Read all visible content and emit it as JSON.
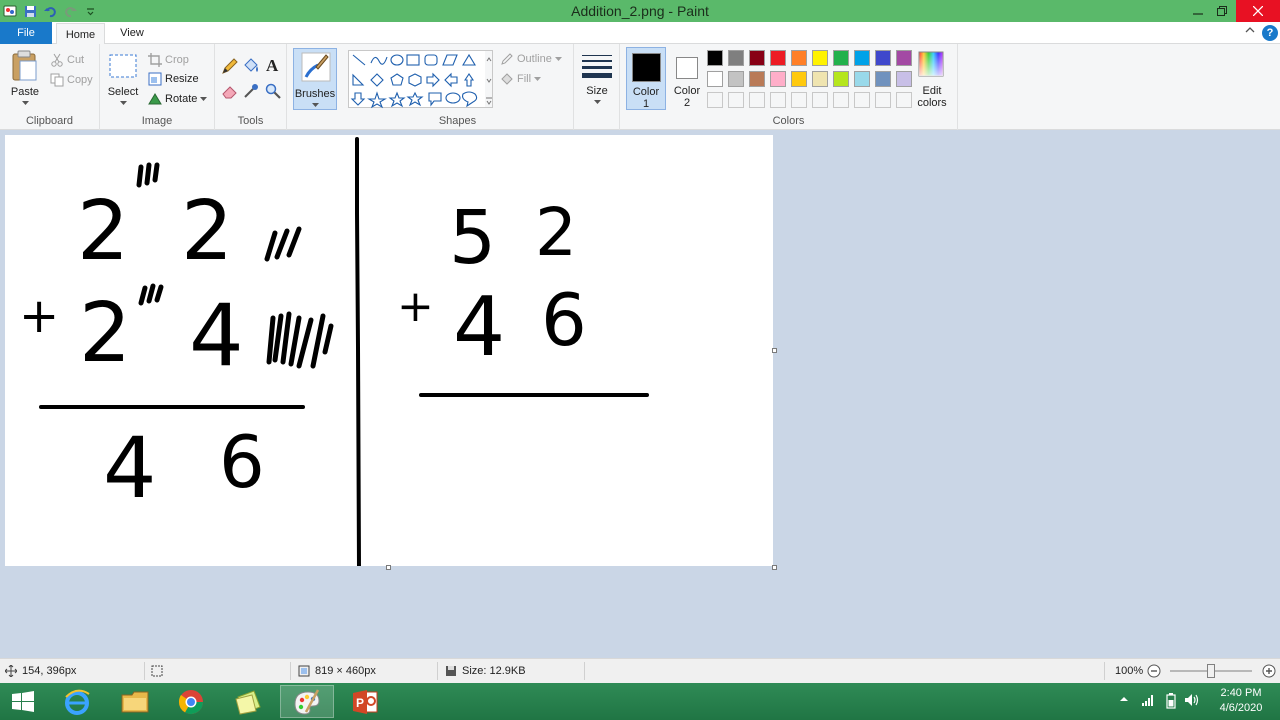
{
  "window": {
    "title": "Addition_2.png - Paint"
  },
  "tabs": {
    "file": "File",
    "home": "Home",
    "view": "View"
  },
  "ribbon": {
    "clipboard": {
      "group_label": "Clipboard",
      "paste": "Paste",
      "cut": "Cut",
      "copy": "Copy"
    },
    "image": {
      "group_label": "Image",
      "select": "Select",
      "crop": "Crop",
      "resize": "Resize",
      "rotate": "Rotate"
    },
    "tools": {
      "group_label": "Tools"
    },
    "brushes": {
      "label": "Brushes"
    },
    "shapes": {
      "group_label": "Shapes",
      "outline": "Outline",
      "fill": "Fill"
    },
    "size": {
      "label": "Size"
    },
    "colors": {
      "group_label": "Colors",
      "color1_line1": "Color",
      "color1_line2": "1",
      "color2_line1": "Color",
      "color2_line2": "2",
      "edit_line1": "Edit",
      "edit_line2": "colors",
      "color1": "#000000",
      "color2": "#ffffff",
      "palette_row1": [
        "#000000",
        "#7f7f7f",
        "#880015",
        "#ed1c24",
        "#ff7f27",
        "#fff200",
        "#22b14c",
        "#00a2e8",
        "#3f48cc",
        "#a349a4"
      ],
      "palette_row2": [
        "#ffffff",
        "#c3c3c3",
        "#b97a57",
        "#ffaec9",
        "#ffc90e",
        "#efe4b0",
        "#b5e61d",
        "#99d9ea",
        "#7092be",
        "#c8bfe7"
      ]
    }
  },
  "canvas": {
    "left_problem": {
      "row1": [
        "2",
        "2"
      ],
      "row2_operator": "+",
      "row2": [
        "2",
        "4"
      ],
      "result": [
        "4",
        "6"
      ]
    },
    "right_problem": {
      "row1": [
        "5",
        "2"
      ],
      "row2_operator": "+",
      "row2": [
        "4",
        "6"
      ]
    }
  },
  "statusbar": {
    "cursor_pos": "154, 396px",
    "dimensions": "819 × 460px",
    "file_size": "Size: 12.9KB",
    "zoom": "100%",
    "zoom_level": 1.0
  },
  "taskbar": {
    "time": "2:40 PM",
    "date": "4/6/2020"
  }
}
